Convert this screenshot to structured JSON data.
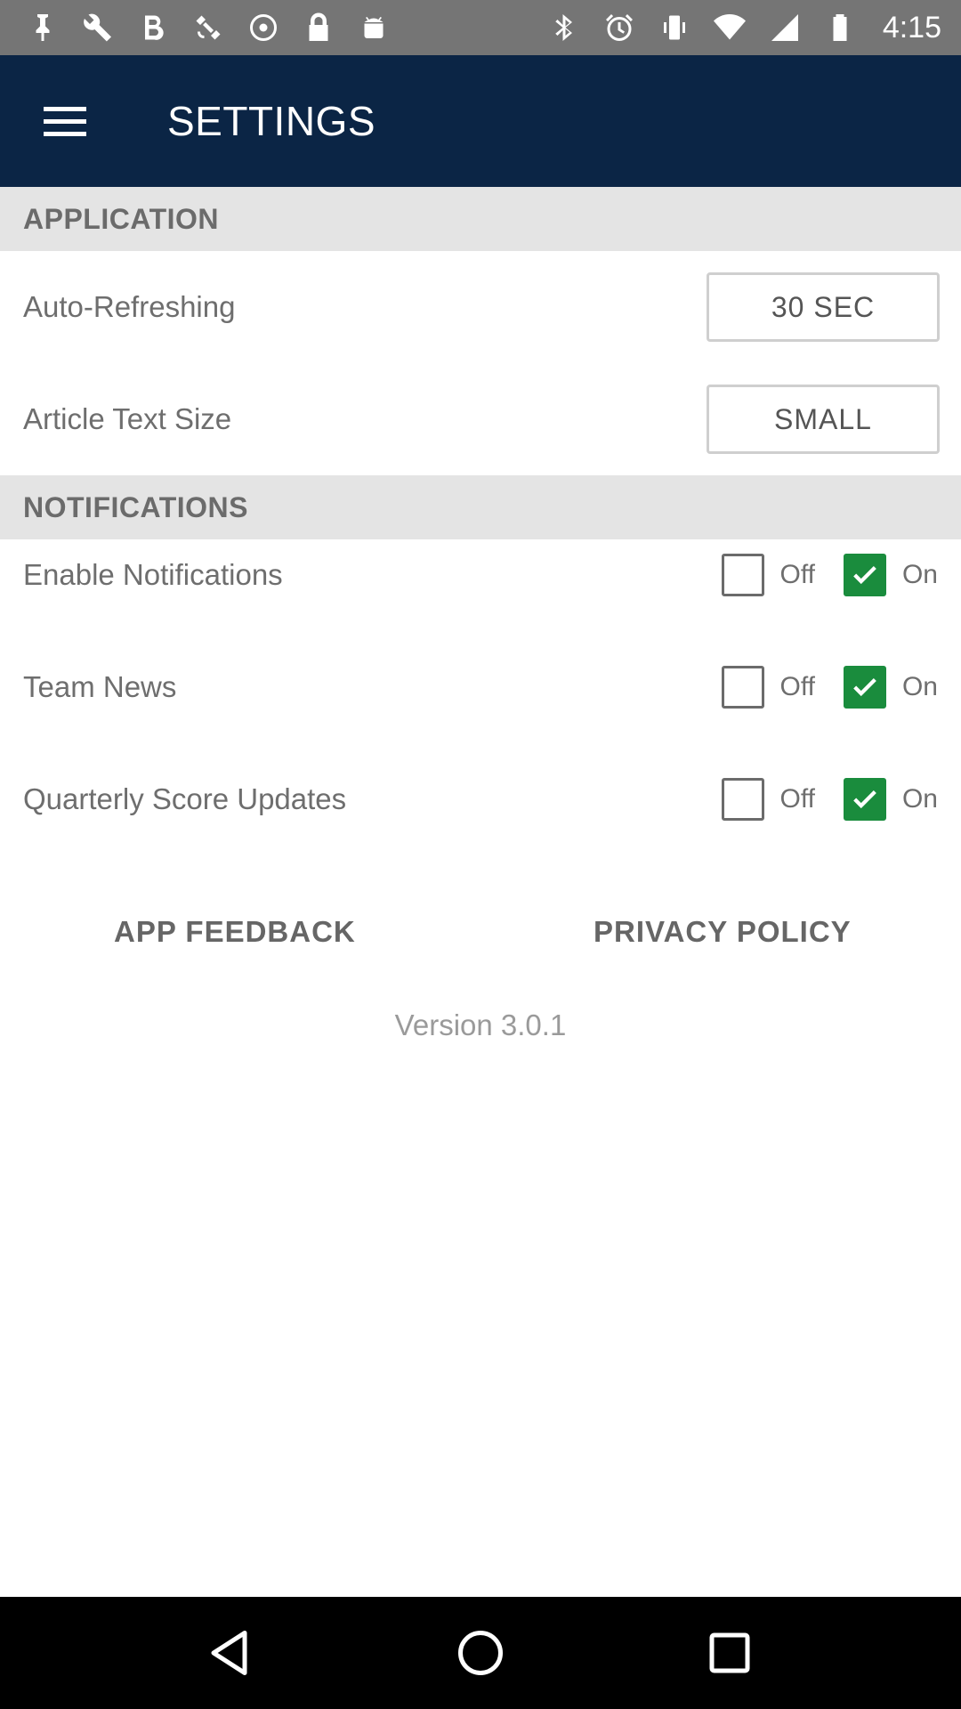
{
  "status_bar": {
    "time": "4:15",
    "left_icons": [
      "pin-icon",
      "wrench-icon",
      "b-icon",
      "satellite-icon",
      "radio-icon",
      "lock-icon",
      "android-icon"
    ],
    "right_icons": [
      "bluetooth-icon",
      "alarm-icon",
      "vibrate-icon",
      "wifi-icon",
      "signal-icon",
      "battery-icon"
    ]
  },
  "app_bar": {
    "title": "SETTINGS",
    "menu_icon": "hamburger-menu-icon"
  },
  "sections": {
    "application": {
      "header": "APPLICATION",
      "auto_refresh_label": "Auto-Refreshing",
      "auto_refresh_value": "30 SEC",
      "text_size_label": "Article Text Size",
      "text_size_value": "SMALL"
    },
    "notifications": {
      "header": "NOTIFICATIONS",
      "items": [
        {
          "label": "Enable Notifications",
          "off_label": "Off",
          "on_label": "On",
          "on": true
        },
        {
          "label": "Team News",
          "off_label": "Off",
          "on_label": "On",
          "on": true
        },
        {
          "label": "Quarterly Score Updates",
          "off_label": "Off",
          "on_label": "On",
          "on": true
        }
      ]
    }
  },
  "links": {
    "feedback": "APP FEEDBACK",
    "privacy": "PRIVACY POLICY"
  },
  "version": "Version 3.0.1",
  "colors": {
    "app_bar": "#0b2545",
    "check_on": "#1a8c3d",
    "section_bg": "#e4e4e4"
  },
  "nav_bar": {
    "buttons": [
      "back-icon",
      "home-icon",
      "recents-icon"
    ]
  }
}
